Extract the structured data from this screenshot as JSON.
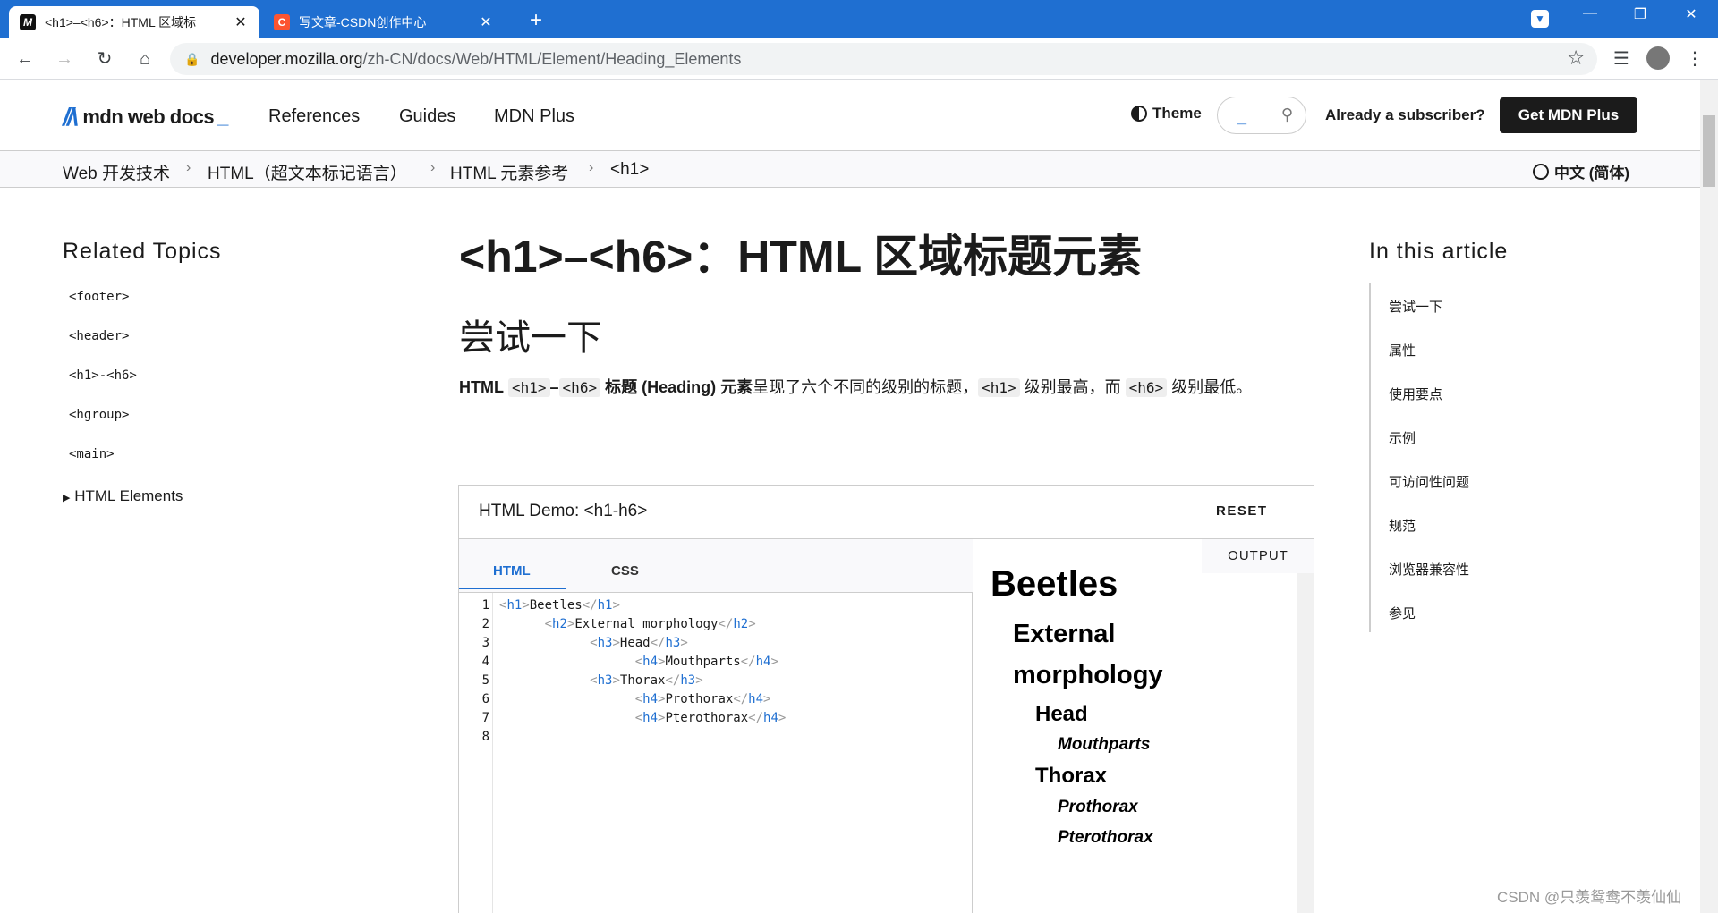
{
  "browser": {
    "tabs": [
      {
        "title": "<h1>–<h6>：HTML 区域标",
        "favicon": "M",
        "active": true
      },
      {
        "title": "写文章-CSDN创作中心",
        "favicon": "C",
        "active": false
      }
    ],
    "url_host": "developer.mozilla.org",
    "url_path": "/zh-CN/docs/Web/HTML/Element/Heading_Elements",
    "icons": [
      "back-icon",
      "forward-icon",
      "reload-icon",
      "home-icon",
      "lock-icon",
      "star-icon",
      "reading-list-icon",
      "profile-icon",
      "menu-icon",
      "minimize-icon",
      "restore-icon",
      "close-icon"
    ]
  },
  "header": {
    "logo": "mdn web docs",
    "nav": [
      "References",
      "Guides",
      "MDN Plus"
    ],
    "theme": "Theme",
    "subscriber": "Already a subscriber?",
    "cta": "Get MDN Plus"
  },
  "breadcrumbs": [
    "Web 开发技术",
    "HTML（超文本标记语言）",
    "HTML 元素参考",
    "<h1>"
  ],
  "language": "中文 (简体)",
  "sidebar": {
    "title": "Related Topics",
    "items": [
      "<footer>",
      "<header>",
      "<h1>-<h6>",
      "<hgroup>",
      "<main>"
    ],
    "group": "HTML Elements"
  },
  "article": {
    "title": "<h1>–<h6>：HTML 区域标题元素",
    "section": "尝试一下",
    "intro_bold_1": "HTML",
    "code_h1": "<h1>",
    "dash": "–",
    "code_h6": "<h6>",
    "intro_bold_2": "标题 (Heading) 元素",
    "intro_text_1": "呈现了六个不同的级别的标题，",
    "intro_text_2": "级别最高，而",
    "intro_text_3": "级别最低。"
  },
  "demo": {
    "title": "HTML Demo: <h1-h6>",
    "reset": "RESET",
    "tabs": [
      "HTML",
      "CSS"
    ],
    "output_label": "OUTPUT",
    "code_lines": [
      {
        "n": "1",
        "indent": "",
        "tag": "h1",
        "text": "Beetles"
      },
      {
        "n": "2",
        "indent": "      ",
        "tag": "h2",
        "text": "External morphology"
      },
      {
        "n": "3",
        "indent": "            ",
        "tag": "h3",
        "text": "Head"
      },
      {
        "n": "4",
        "indent": "                  ",
        "tag": "h4",
        "text": "Mouthparts"
      },
      {
        "n": "5",
        "indent": "            ",
        "tag": "h3",
        "text": "Thorax"
      },
      {
        "n": "6",
        "indent": "                  ",
        "tag": "h4",
        "text": "Prothorax"
      },
      {
        "n": "7",
        "indent": "                  ",
        "tag": "h4",
        "text": "Pterothorax"
      },
      {
        "n": "8",
        "indent": "",
        "tag": "",
        "text": ""
      }
    ],
    "output": {
      "h1": "Beetles",
      "h2_line1": "External",
      "h2_line2": "morphology",
      "h3a": "Head",
      "h4a": "Mouthparts",
      "h3b": "Thorax",
      "h4b": "Prothorax",
      "h4c": "Pterothorax"
    }
  },
  "toc": {
    "title": "In this article",
    "items": [
      "尝试一下",
      "属性",
      "使用要点",
      "示例",
      "可访问性问题",
      "规范",
      "浏览器兼容性",
      "参见"
    ]
  },
  "watermark": "CSDN @只羡鸳鸯不羡仙仙"
}
